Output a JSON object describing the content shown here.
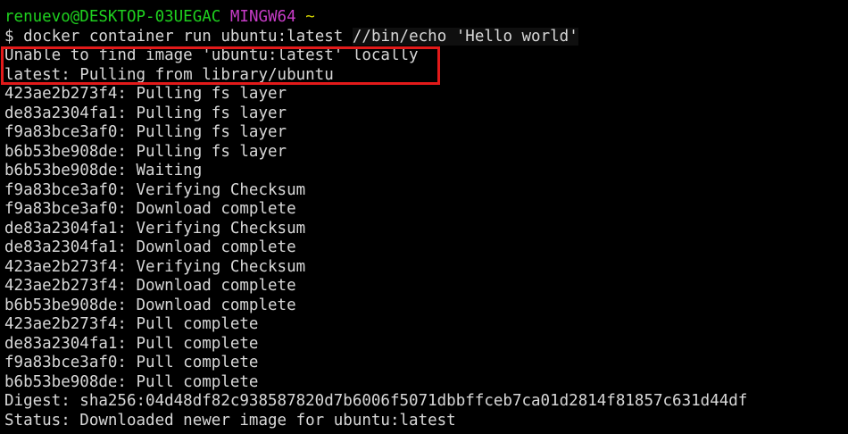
{
  "prompt": {
    "user_host": "renuevo@DESKTOP-03UEGAC",
    "system": "MINGW64",
    "path": "~"
  },
  "command": {
    "symbol": "$",
    "text": "docker container run ubuntu:latest",
    "args": "//bin/echo 'Hello world'"
  },
  "output": [
    "Unable to find image 'ubuntu:latest' locally",
    "latest: Pulling from library/ubuntu",
    "423ae2b273f4: Pulling fs layer",
    "de83a2304fa1: Pulling fs layer",
    "f9a83bce3af0: Pulling fs layer",
    "b6b53be908de: Pulling fs layer",
    "b6b53be908de: Waiting",
    "f9a83bce3af0: Verifying Checksum",
    "f9a83bce3af0: Download complete",
    "de83a2304fa1: Verifying Checksum",
    "de83a2304fa1: Download complete",
    "423ae2b273f4: Verifying Checksum",
    "423ae2b273f4: Download complete",
    "b6b53be908de: Download complete",
    "423ae2b273f4: Pull complete",
    "de83a2304fa1: Pull complete",
    "f9a83bce3af0: Pull complete",
    "b6b53be908de: Pull complete",
    "Digest: sha256:04d48df82c938587820d7b6006f5071dbbffceb7ca01d2814f81857c631d44df",
    "Status: Downloaded newer image for ubuntu:latest"
  ],
  "colors": {
    "background": "#000000",
    "text": "#d8d8d8",
    "prompt_user": "#1fd11f",
    "prompt_system": "#c83cc8",
    "prompt_path": "#d6d600",
    "highlight_border": "#e21a1a"
  }
}
